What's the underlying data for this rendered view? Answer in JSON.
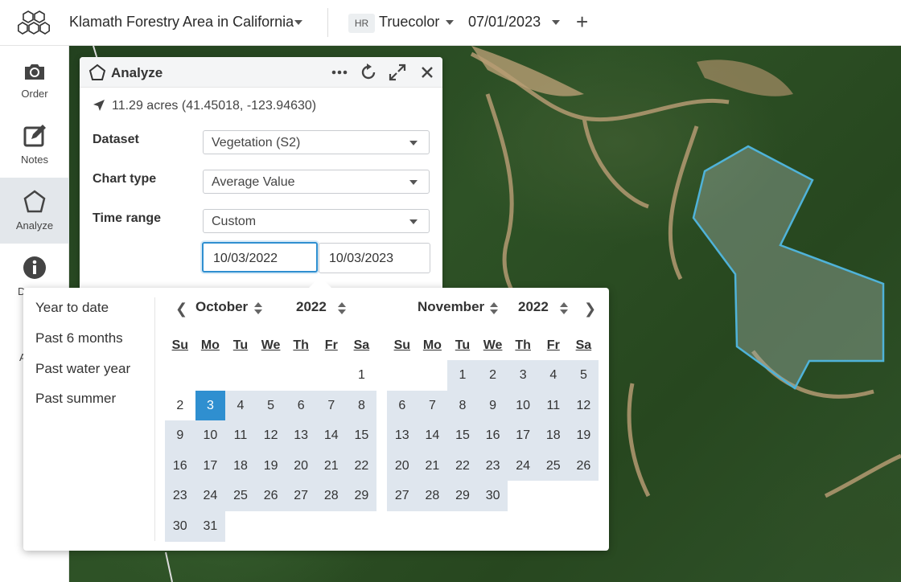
{
  "topbar": {
    "area_title": "Klamath Forestry Area in California",
    "layer_badge": "HR",
    "layer_name": "Truecolor",
    "date": "07/01/2023",
    "add_label": "+"
  },
  "rail": {
    "items": [
      {
        "label": "Order",
        "icon": "camera-icon"
      },
      {
        "label": "Notes",
        "icon": "edit-icon"
      },
      {
        "label": "Analyze",
        "icon": "polygon-icon",
        "active": true
      },
      {
        "label": "D",
        "icon": "info-icon"
      },
      {
        "label": "A",
        "icon": ""
      }
    ]
  },
  "panel": {
    "title": "Analyze",
    "location": "11.29 acres (41.45018, -123.94630)",
    "dataset_label": "Dataset",
    "dataset_value": "Vegetation (S2)",
    "chart_type_label": "Chart type",
    "chart_type_value": "Average Value",
    "time_range_label": "Time range",
    "time_range_value": "Custom",
    "start_date": "10/03/2022",
    "end_date": "10/03/2023"
  },
  "picker": {
    "presets": [
      "Year to date",
      "Past 6 months",
      "Past water year",
      "Past summer"
    ],
    "weekdays": [
      "Su",
      "Mo",
      "Tu",
      "We",
      "Th",
      "Fr",
      "Sa"
    ],
    "months": [
      {
        "month": "October",
        "year": "2022",
        "first_weekday": 6,
        "days": 31,
        "selected": 3
      },
      {
        "month": "November",
        "year": "2022",
        "first_weekday": 2,
        "days": 30,
        "selected": null
      }
    ]
  },
  "colors": {
    "accent": "#2f8fd0",
    "range": "#dfe6ee",
    "polygon": "#4fb3d9"
  }
}
